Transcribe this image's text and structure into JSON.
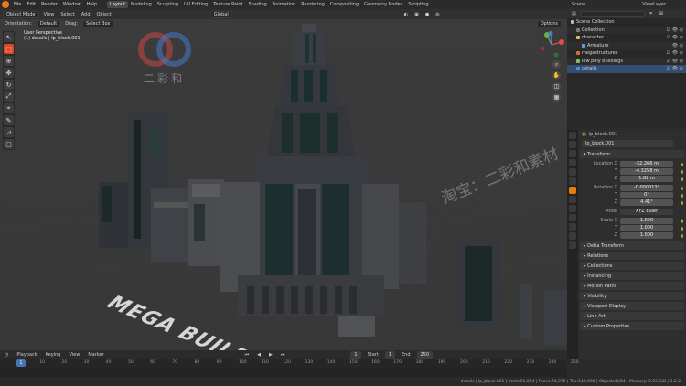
{
  "app": {
    "name": "Blender"
  },
  "top_menu": {
    "items": [
      "File",
      "Edit",
      "Render",
      "Window",
      "Help"
    ]
  },
  "workspaces": {
    "items": [
      "Layout",
      "Modeling",
      "Sculpting",
      "UV Editing",
      "Texture Paint",
      "Shading",
      "Animation",
      "Rendering",
      "Compositing",
      "Geometry Nodes",
      "Scripting"
    ],
    "active": "Layout"
  },
  "scene": {
    "label": "Scene",
    "view_layer": "ViewLayer"
  },
  "viewport": {
    "mode": "Object Mode",
    "menus": [
      "View",
      "Select",
      "Add",
      "Object"
    ],
    "transform_orientation": "Global",
    "orientation_label": "Orientation:",
    "orientation_value": "Default",
    "drag_label": "Drag:",
    "drag_value": "Select Box",
    "options_label": "Options",
    "perspective": "User Perspective",
    "selection_info": "(1) details | lp_block.001",
    "scene_text": "MEGA BUILDI"
  },
  "watermark": {
    "logo_text": "二彩和",
    "overlay_text": "淘宝：二彩和素材"
  },
  "outliner": {
    "root": "Scene Collection",
    "items": [
      {
        "name": "Collection",
        "color": "#7a7a7a"
      },
      {
        "name": "character",
        "color": "#e0c060"
      },
      {
        "name": "Armature",
        "color": "#6aa0d0"
      },
      {
        "name": "megastructures",
        "color": "#d07030"
      },
      {
        "name": "low poly buildings",
        "color": "#7ac060"
      },
      {
        "name": "details",
        "color": "#4a90d0"
      }
    ]
  },
  "properties": {
    "object_name": "lp_block.001",
    "object_field": "lp_block.001",
    "transform_title": "Transform",
    "location": {
      "label": "Location X",
      "x": "-32.266 m",
      "y": "-4.3258 m",
      "z": "1.82 m"
    },
    "rotation": {
      "label": "Rotation X",
      "x": "-0.000013°",
      "y": "0°",
      "z": "4.41°"
    },
    "mode": {
      "label": "Mode",
      "value": "XYZ Euler"
    },
    "scale": {
      "label": "Scale X",
      "x": "1.000",
      "y": "1.000",
      "z": "1.000"
    },
    "axis_y": "Y",
    "axis_z": "Z",
    "sections": [
      "Delta Transform",
      "Relations",
      "Collections",
      "Instancing",
      "Motion Paths",
      "Visibility",
      "Viewport Display",
      "Line Art",
      "Custom Properties"
    ]
  },
  "timeline": {
    "menus": [
      "Playback",
      "Keying",
      "View",
      "Marker"
    ],
    "current_frame": "1",
    "start_label": "Start",
    "start": "1",
    "end_label": "End",
    "end": "250",
    "ticks": [
      "0",
      "10",
      "20",
      "30",
      "40",
      "50",
      "60",
      "70",
      "80",
      "90",
      "100",
      "110",
      "120",
      "130",
      "140",
      "150",
      "160",
      "170",
      "180",
      "190",
      "200",
      "210",
      "220",
      "230",
      "240",
      "250"
    ]
  },
  "status": {
    "text": "details | lp_block.001 | Verts:91,094 | Faces:74,376 | Tris:140,906 | Objects:0/84 | Memory: 3.93 GiB | 3.2.2"
  },
  "colors": {
    "accent": "#4772b3",
    "active_tool": "#e0482e",
    "orange": "#e87d0d"
  }
}
